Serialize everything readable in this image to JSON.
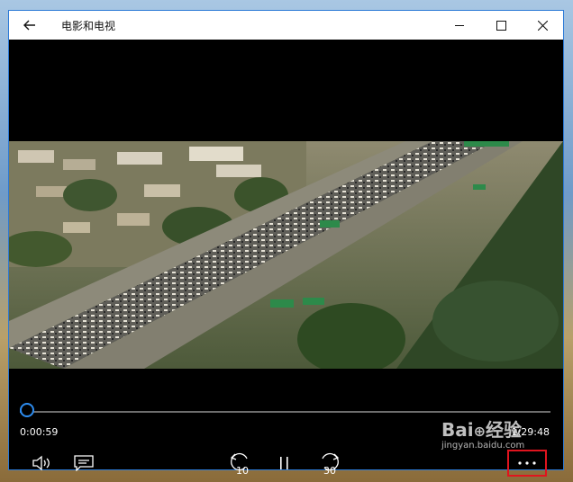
{
  "app": {
    "title": "电影和电视"
  },
  "player": {
    "current_time": "0:00:59",
    "total_time": "1:29:48",
    "progress": 0.011,
    "skip_back_label": "10",
    "skip_forward_label": "30"
  },
  "icons": {
    "back": "back-arrow-icon",
    "minimize": "minimize-icon",
    "maximize": "maximize-icon",
    "close": "close-icon",
    "volume": "volume-icon",
    "captions": "captions-icon",
    "skip_back": "skip-back-10-icon",
    "pause": "pause-icon",
    "skip_forward": "skip-forward-30-icon",
    "more": "more-options-icon"
  },
  "colors": {
    "accent": "#2d8cf0",
    "highlight": "#e0141e"
  }
}
